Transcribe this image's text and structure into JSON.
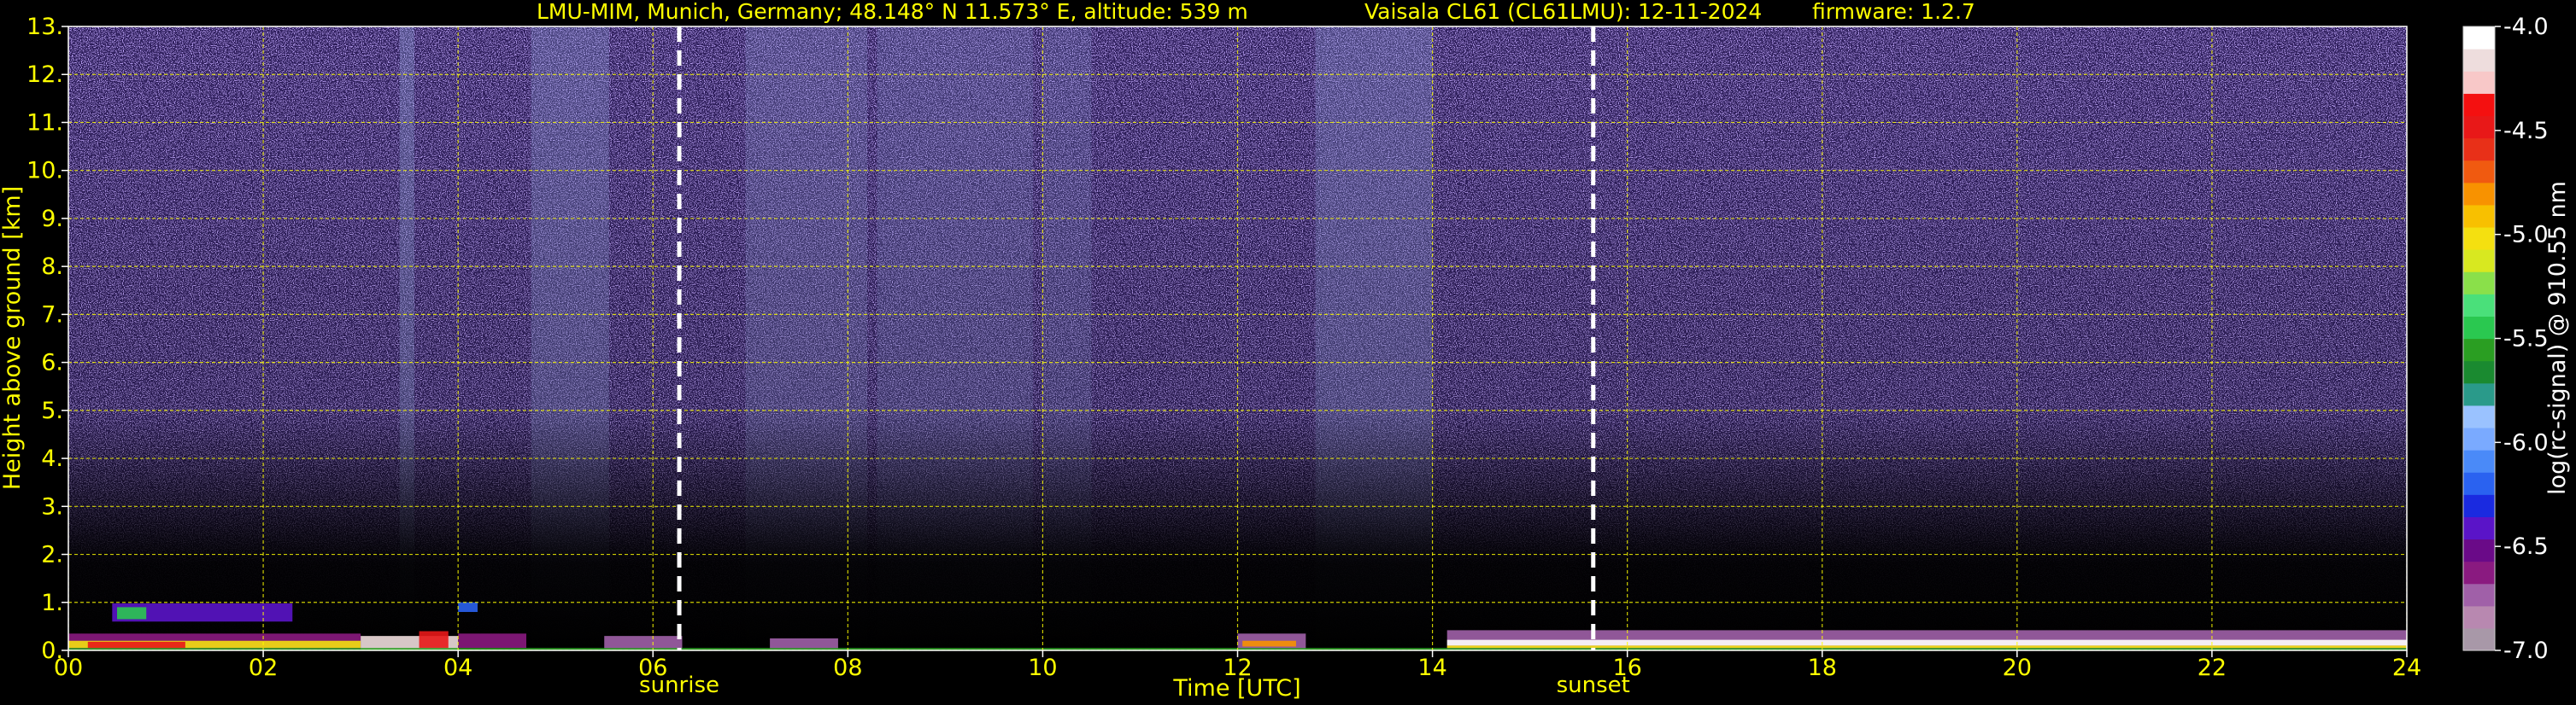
{
  "header": {
    "station": "LMU-MIM, Munich, Germany; 48.148° N 11.573° E, altitude: 539 m",
    "instrument": "Vaisala CL61 (CL61LMU): 12-11-2024",
    "firmware": "firmware: 1.2.7"
  },
  "chart_data": {
    "type": "heatmap",
    "title": "LMU-MIM, Munich, Germany; 48.148° N 11.573° E, altitude: 539 m    Vaisala CL61 (CL61LMU): 12-11-2024    firmware: 1.2.7",
    "xlabel": "Time [UTC]",
    "ylabel": "Height above ground [km]",
    "xlim": [
      0,
      24
    ],
    "ylim": [
      0,
      13
    ],
    "x_tick_labels": [
      "00",
      "02",
      "04",
      "06",
      "08",
      "10",
      "12",
      "14",
      "16",
      "18",
      "20",
      "22",
      "24"
    ],
    "x_ticks": [
      0,
      2,
      4,
      6,
      8,
      10,
      12,
      14,
      16,
      18,
      20,
      22,
      24
    ],
    "y_tick_labels": [
      "0.",
      "1.",
      "2.",
      "3.",
      "4.",
      "5.",
      "6.",
      "7.",
      "8.",
      "9.",
      "10.",
      "11.",
      "12.",
      "13."
    ],
    "y_ticks": [
      0,
      1,
      2,
      3,
      4,
      5,
      6,
      7,
      8,
      9,
      10,
      11,
      12,
      13
    ],
    "grid": true,
    "grid_color": "#ffff00",
    "markers": [
      {
        "label": "sunrise",
        "x": 6.27
      },
      {
        "label": "sunset",
        "x": 15.65
      }
    ],
    "colorbar": {
      "label": "log(rc-signal) @ 910.55 nm",
      "range": [
        -7.0,
        -4.0
      ],
      "tick_labels": [
        "-4.0",
        "-4.5",
        "-5.0",
        "-5.5",
        "-6.0",
        "-6.5",
        "-7.0"
      ],
      "ticks": [
        -4.0,
        -4.5,
        -5.0,
        -5.5,
        -6.0,
        -6.5,
        -7.0
      ],
      "colors": [
        "#a898a8",
        "#b888b0",
        "#a060a8",
        "#8a1a80",
        "#6a0a88",
        "#5a14c8",
        "#1a2ae0",
        "#2a62f0",
        "#4a8af8",
        "#7aaaff",
        "#9ac2ff",
        "#2a9a8a",
        "#1a8a30",
        "#2a9e22",
        "#2ac850",
        "#4ae07a",
        "#8ae04a",
        "#d8e820",
        "#f4e010",
        "#f8c000",
        "#f89200",
        "#f05a10",
        "#e83018",
        "#e81818",
        "#f41010",
        "#f8c8c8",
        "#eedddd",
        "#ffffff"
      ]
    },
    "visible_backscatter_regions": {
      "noise_upper_km": 13,
      "low_cloud_top_km": 1.0,
      "boundary_layer_top_km": 0.5
    }
  }
}
